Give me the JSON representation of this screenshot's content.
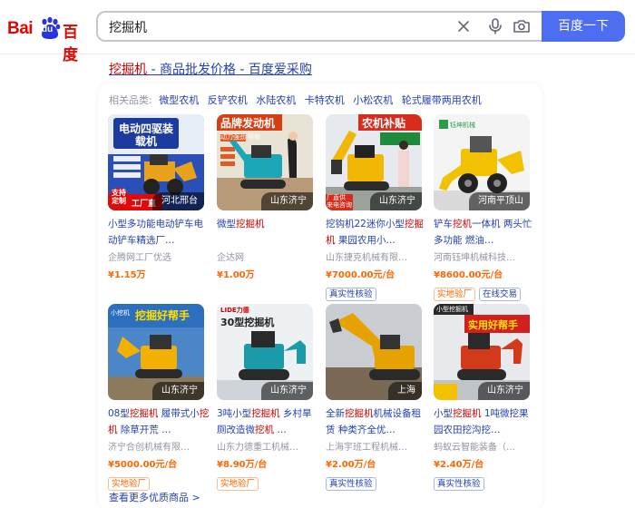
{
  "header": {
    "logo": {
      "bai": "Bai",
      "du": "du",
      "cn": "百度"
    },
    "query": "挖掘机",
    "search_button": "百度一下"
  },
  "result": {
    "title_highlight": "挖掘机",
    "title_rest": " - 商品批发价格 - 百度爱采购"
  },
  "related": {
    "label": "相关品类:",
    "items": [
      "微型农机",
      "反铲农机",
      "水陆农机",
      "卡特农机",
      "小松农机",
      "轮式履带两用农机"
    ]
  },
  "products": [
    {
      "location": "河北邢台",
      "title_parts": [
        {
          "t": "小型多功能电动铲车电动铲车精选厂…",
          "hl": false
        }
      ],
      "seller": "企腾网工厂优选",
      "price": "¥1.15万",
      "tags": [],
      "thumb_text": "电动四驱装载机",
      "thumb_text2": "工厂直",
      "thumb_badge": "支持定制"
    },
    {
      "location": "山东济宁",
      "title_parts": [
        {
          "t": "微型",
          "hl": false
        },
        {
          "t": "挖掘机",
          "hl": true
        }
      ],
      "seller": "企达网",
      "price": "¥1.00万",
      "tags": [],
      "thumb_text": "品牌发动机",
      "thumb_text2": "动力强劲 轻松"
    },
    {
      "location": "山东济宁",
      "title_parts": [
        {
          "t": "挖钩机22迷你小型",
          "hl": false
        },
        {
          "t": "挖掘机",
          "hl": true
        },
        {
          "t": " 果园农用小…",
          "hl": false
        }
      ],
      "seller": "山东捷克机械有限…",
      "price": "¥7000.00元/台",
      "tags": [
        {
          "label": "真实性核验",
          "style": "blue"
        }
      ],
      "thumb_text": "农机补贴",
      "thumb_text2": "厂直供 来电咨询"
    },
    {
      "location": "河南平顶山",
      "title_parts": [
        {
          "t": "铲车",
          "hl": false
        },
        {
          "t": "挖机",
          "hl": true
        },
        {
          "t": "一体机 两头忙多功能 燃油…",
          "hl": false
        }
      ],
      "seller": "河南钰坤机械科技…",
      "price": "¥8600.00元/台",
      "tags": [
        {
          "label": "实地验厂",
          "style": "orange"
        },
        {
          "label": "在线交易",
          "style": "blue"
        }
      ],
      "thumb_text": "钰坤机械"
    },
    {
      "location": "山东济宁",
      "title_parts": [
        {
          "t": "08型",
          "hl": false
        },
        {
          "t": "挖掘机",
          "hl": true
        },
        {
          "t": " 履带式小",
          "hl": false
        },
        {
          "t": "挖机",
          "hl": true
        },
        {
          "t": " 除草开荒 …",
          "hl": false
        }
      ],
      "seller": "济宁合创机械有限…",
      "price": "¥5000.00元/台",
      "tags": [
        {
          "label": "实地验厂",
          "style": "orange"
        }
      ],
      "thumb_text": "挖掘好帮手",
      "thumb_text2": "小挖机"
    },
    {
      "location": "山东济宁",
      "title_parts": [
        {
          "t": "3吨小型",
          "hl": false
        },
        {
          "t": "挖掘机",
          "hl": true
        },
        {
          "t": " 乡村旱厕改造微",
          "hl": false
        },
        {
          "t": "挖机",
          "hl": true
        },
        {
          "t": " …",
          "hl": false
        }
      ],
      "seller": "山东力德重工机械…",
      "price": "¥8.90万/台",
      "tags": [
        {
          "label": "实地验厂",
          "style": "orange"
        }
      ],
      "thumb_text": "30型挖掘机",
      "thumb_text2": "LIDE力德"
    },
    {
      "location": "上海",
      "title_parts": [
        {
          "t": "全新",
          "hl": false
        },
        {
          "t": "挖掘机",
          "hl": true
        },
        {
          "t": "机械设备租赁 种类齐全优…",
          "hl": false
        }
      ],
      "seller": "上海宇班工程机械…",
      "price": "¥2.00万/台",
      "tags": [
        {
          "label": "真实性核验",
          "style": "blue"
        }
      ]
    },
    {
      "location": "山东济宁",
      "title_parts": [
        {
          "t": "小型",
          "hl": false
        },
        {
          "t": "挖掘机",
          "hl": true
        },
        {
          "t": " 1吨微挖果园农田挖沟挖…",
          "hl": false
        }
      ],
      "seller": "蚂蚁云智能装备（…",
      "price": "¥2.40万/台",
      "tags": [
        {
          "label": "真实性核验",
          "style": "blue"
        }
      ],
      "thumb_text": "实用好帮手",
      "thumb_text2": "小型挖掘机"
    }
  ],
  "more_link": "查看更多优质商品 >",
  "colors": {
    "accent": "#4e6ef2",
    "link": "#2440b3",
    "highlight": "#cc0000",
    "price": "#ff6600",
    "muted": "#9195a3",
    "brand_red": "#e10601"
  },
  "icons": [
    "clear-icon",
    "microphone-icon",
    "camera-icon"
  ]
}
